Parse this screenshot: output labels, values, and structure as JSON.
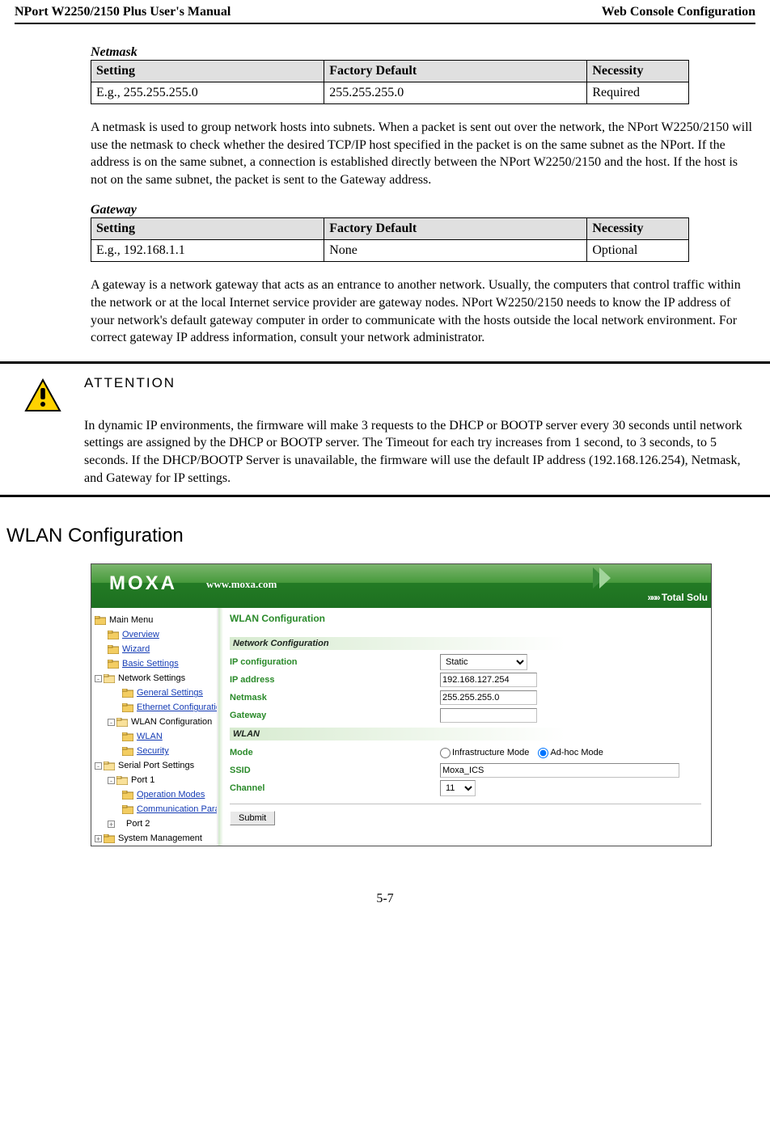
{
  "header": {
    "left": "NPort W2250/2150 Plus User's Manual",
    "right": "Web Console Configuration"
  },
  "netmask": {
    "label": "Netmask",
    "head": {
      "c1": "Setting",
      "c2": "Factory Default",
      "c3": "Necessity"
    },
    "row": {
      "c1": "E.g., 255.255.255.0",
      "c2": "255.255.255.0",
      "c3": "Required"
    },
    "para": "A netmask is used to group network hosts into subnets. When a packet is sent out over the network, the NPort W2250/2150 will use the netmask to check whether the desired TCP/IP host specified in the packet is on the same subnet as the NPort. If the address is on the same subnet, a connection is established directly between the NPort W2250/2150 and the host. If the host is not on the same subnet, the packet is sent to the Gateway address."
  },
  "gateway": {
    "label": "Gateway",
    "head": {
      "c1": "Setting",
      "c2": "Factory Default",
      "c3": "Necessity"
    },
    "row": {
      "c1": "E.g., 192.168.1.1",
      "c2": "None",
      "c3": "Optional"
    },
    "para": "A gateway is a network gateway that acts as an entrance to another network. Usually, the computers that control traffic within the network or at the local Internet service provider are gateway nodes. NPort W2250/2150 needs to know the IP address of your network's default gateway computer in order to communicate with the hosts outside the local network environment. For correct gateway IP address information, consult your network administrator."
  },
  "attention": {
    "title": "ATTENTION",
    "text": "In dynamic IP environments, the firmware will make 3 requests to the DHCP or BOOTP server every 30 seconds until network settings are assigned by the DHCP or BOOTP server. The Timeout for each try increases from 1 second, to 3 seconds, to 5 seconds. If the DHCP/BOOTP Server is unavailable, the firmware will use the default IP address (192.168.126.254), Netmask, and Gateway for IP settings."
  },
  "h2": "WLAN Configuration",
  "shot": {
    "logo": "MOXA",
    "url": "www.moxa.com",
    "totalPrefix": "»»»",
    "total": " Total Solu",
    "tree": {
      "main": "Main Menu",
      "overview": "Overview",
      "wizard": "Wizard",
      "basic": "Basic Settings",
      "net": "Network Settings",
      "gen": "General Settings",
      "eth": "Ethernet Configuration",
      "wlanc": "WLAN Configuration",
      "wlan": "WLAN",
      "sec": "Security",
      "serial": "Serial Port Settings",
      "port1": "Port 1",
      "op": "Operation Modes",
      "comm": "Communication Paran",
      "port2": "Port 2",
      "sys": "System Management"
    },
    "main": {
      "title": "WLAN Configuration",
      "netconf": "Network Configuration",
      "ipconf": "IP configuration",
      "ipconf_val": "Static",
      "ipaddr": "IP address",
      "ipaddr_val": "192.168.127.254",
      "netmask": "Netmask",
      "netmask_val": "255.255.255.0",
      "gateway": "Gateway",
      "gateway_val": "",
      "wlan": "WLAN",
      "mode": "Mode",
      "mode_infra": "Infrastructure Mode",
      "mode_adhoc": "Ad-hoc Mode",
      "ssid": "SSID",
      "ssid_val": "Moxa_ICS",
      "channel": "Channel",
      "channel_val": "11",
      "submit": "Submit"
    }
  },
  "pagenum": "5-7"
}
